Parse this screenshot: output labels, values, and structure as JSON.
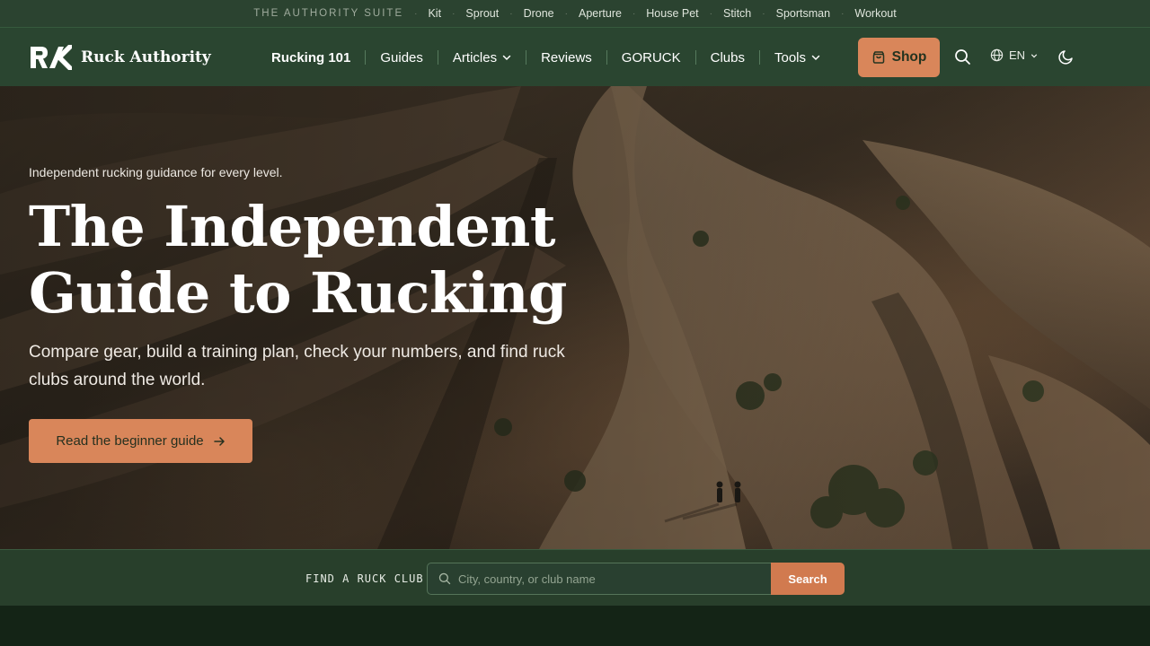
{
  "suite": {
    "label": "THE AUTHORITY SUITE",
    "links": [
      "Kit",
      "Sprout",
      "Drone",
      "Aperture",
      "House Pet",
      "Stitch",
      "Sportsman",
      "Workout"
    ]
  },
  "nav": {
    "brand": "Ruck Authority",
    "items": {
      "rucking101": "Rucking 101",
      "guides": "Guides",
      "articles": "Articles",
      "reviews": "Reviews",
      "goruck": "GORUCK",
      "clubs": "Clubs",
      "tools": "Tools"
    },
    "shop_label": "Shop",
    "language": "EN"
  },
  "hero": {
    "eyebrow": "Independent rucking guidance for every level.",
    "headline_line1": "The Independent",
    "headline_line2": "Guide to Rucking",
    "subhead": "Compare gear, build a training plan, check your numbers, and find ruck clubs around the world.",
    "cta_label": "Read the beginner guide"
  },
  "finder": {
    "label": "FIND A RUCK CLUB",
    "placeholder": "City, country, or club name",
    "value": "",
    "button_label": "Search"
  },
  "colors": {
    "brand_green": "#2a4530",
    "accent_orange": "#d9865a",
    "dark_green": "#142416"
  },
  "icons": {
    "shop": "shopping-bag-icon",
    "search": "search-icon",
    "language": "globe-icon",
    "theme": "moon-icon",
    "cta": "arrow-right-icon"
  }
}
